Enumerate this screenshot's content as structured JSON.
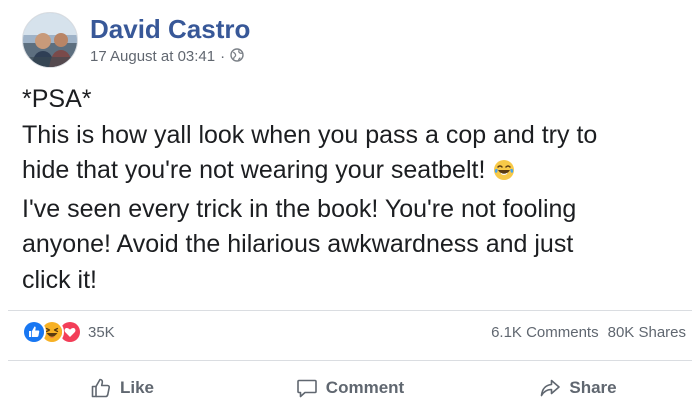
{
  "post": {
    "author": "David Castro",
    "timestamp": "17 August at 03:41",
    "separator": "·",
    "privacy_icon": "globe-icon",
    "avatar_icon": "profile-photo",
    "body_lines": [
      "*PSA*",
      "This is how yall look when you pass a cop and try to",
      "hide that you're not wearing your seatbelt!",
      "I've seen every trick in the book! You're not fooling",
      "anyone! Avoid the hilarious awkwardness and just",
      "click it!"
    ],
    "inline_emoji": "laughing-tears-emoji"
  },
  "stats": {
    "reactions": [
      "like-reaction-icon",
      "haha-reaction-icon",
      "love-reaction-icon"
    ],
    "reaction_count": "35K",
    "comments": "6.1K Comments",
    "shares": "80K Shares"
  },
  "actions": {
    "like": "Like",
    "comment": "Comment",
    "share": "Share"
  },
  "colors": {
    "author": "#385898",
    "meta": "#616770",
    "text": "#1c1e21",
    "action": "#606770",
    "like_blue": "#1877f2",
    "love_red": "#f33e58",
    "haha_yellow": "#f7b125",
    "divider": "#dadde1"
  }
}
